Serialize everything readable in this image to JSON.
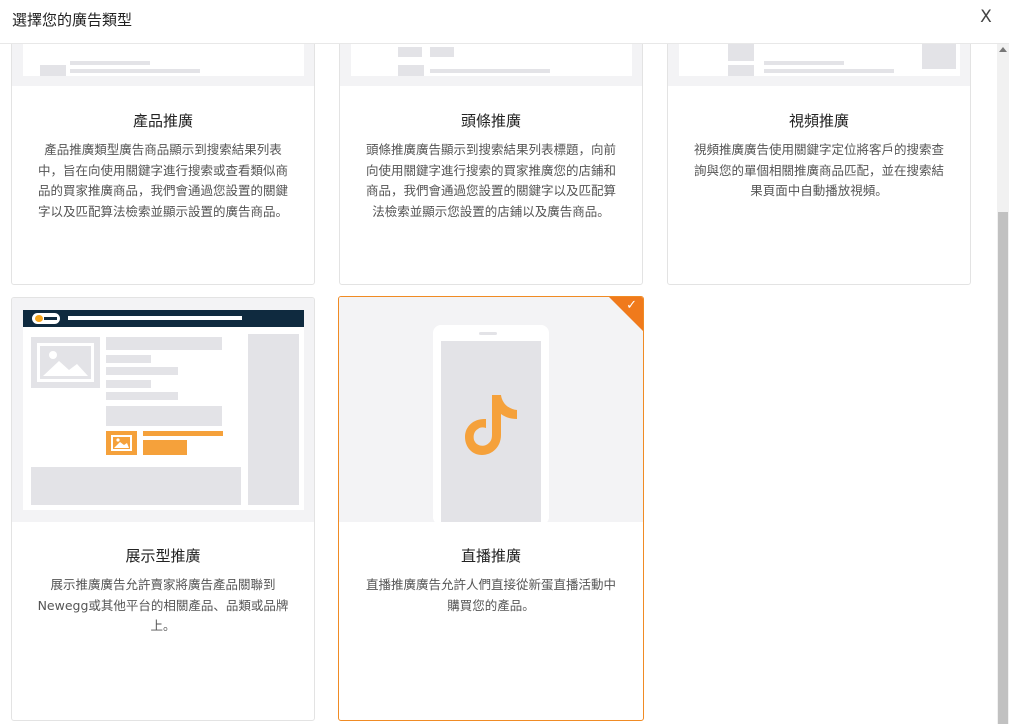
{
  "header": {
    "title": "選擇您的廣告類型",
    "close_label": "X"
  },
  "cards": [
    {
      "title": "產品推廣",
      "description": "產品推廣類型廣告商品顯示到搜索結果列表中，旨在向使用關鍵字進行搜索或查看類似商品的買家推廣商品，我們會通過您設置的關鍵字以及匹配算法檢索並顯示設置的廣告商品。",
      "selected": false
    },
    {
      "title": "頭條推廣",
      "description": "頭條推廣廣告顯示到搜索結果列表標題，向前向使用關鍵字進行搜索的買家推廣您的店鋪和商品，我們會通過您設置的關鍵字以及匹配算法檢索並顯示您設置的店鋪以及廣告商品。",
      "selected": false
    },
    {
      "title": "視頻推廣",
      "description": "視頻推廣廣告使用關鍵字定位將客戶的搜索查詢與您的單個相關推廣商品匹配，並在搜索結果頁面中自動播放視頻。",
      "selected": false
    },
    {
      "title": "展示型推廣",
      "description": "展示推廣廣告允許賣家將廣告產品關聯到Newegg或其他平台的相關產品、品類或品牌上。",
      "selected": false
    },
    {
      "title": "直播推廣",
      "description": "直播推廣廣告允許人們直接從新蛋直播活動中購買您的產品。",
      "selected": true
    }
  ],
  "icons": {
    "close": "close-icon",
    "check": "check-icon",
    "video_app": "tiktok-logo-icon",
    "brand": "newegg-logo-icon",
    "image_placeholder": "image-placeholder-icon"
  },
  "colors": {
    "accent": "#f07a1c",
    "brand_bar": "#0f2a3f",
    "placeholder": "#e3e3e7"
  }
}
